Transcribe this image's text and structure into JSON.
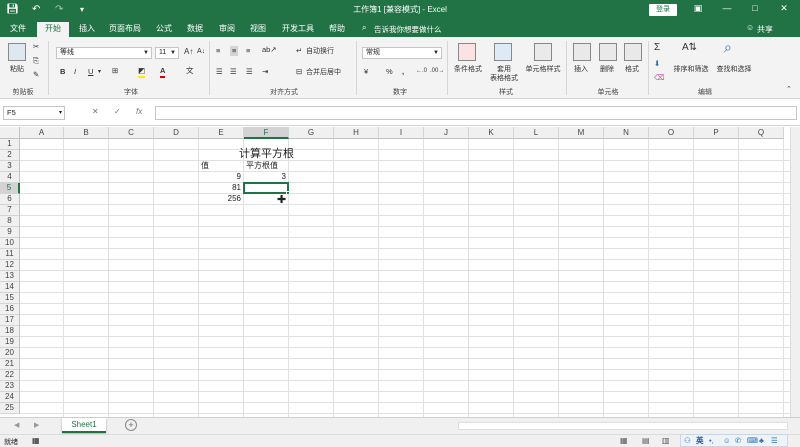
{
  "window": {
    "title": "工作簿1 [兼容模式] - Excel",
    "login_label": "登录",
    "share_label": "共享",
    "accent_color": "#217346"
  },
  "quick_access": {
    "icons": [
      "save-icon",
      "undo-icon",
      "redo-icon",
      "customize-icon"
    ]
  },
  "tabs": [
    "文件",
    "开始",
    "插入",
    "页面布局",
    "公式",
    "数据",
    "审阅",
    "视图",
    "开发工具",
    "帮助"
  ],
  "active_tab": "开始",
  "tell_me": "告诉我你想要做什么",
  "ribbon": {
    "clipboard": {
      "paste_label": "粘贴",
      "group_label": "剪贴板"
    },
    "font": {
      "font_name": "等线",
      "font_size": "11",
      "group_label": "字体"
    },
    "alignment": {
      "wrap_label": "自动换行",
      "merge_label": "合并后居中",
      "group_label": "对齐方式"
    },
    "number": {
      "format": "常规",
      "percent": "%",
      "comma": ",",
      "group_label": "数字"
    },
    "styles": {
      "conditional_label": "条件格式",
      "table_label": "套用\n表格格式",
      "cell_styles_label": "单元格样式",
      "group_label": "样式"
    },
    "cells": {
      "insert_label": "插入",
      "delete_label": "删除",
      "format_label": "格式",
      "group_label": "单元格"
    },
    "editing": {
      "sort_label": "排序和筛选",
      "find_label": "查找和选择",
      "group_label": "编辑"
    }
  },
  "formula_bar": {
    "name_box": "F5",
    "fx_label": "fx",
    "formula": ""
  },
  "columns": [
    "A",
    "B",
    "C",
    "D",
    "E",
    "F",
    "G",
    "H",
    "I",
    "J",
    "K",
    "L",
    "M",
    "N",
    "O",
    "P",
    "Q"
  ],
  "rows": [
    "1",
    "2",
    "3",
    "4",
    "5",
    "6",
    "7",
    "8",
    "9",
    "10",
    "11",
    "12",
    "13",
    "14",
    "15",
    "16",
    "17",
    "18",
    "19",
    "20",
    "21",
    "22",
    "23",
    "24",
    "25"
  ],
  "selected_cell": "F5",
  "cells": {
    "title": "计算平方根",
    "header_value": "值",
    "header_sqrt": "平方根值",
    "e4": "9",
    "f4": "3",
    "e5": "81",
    "e6": "256"
  },
  "sheets": [
    "Sheet1"
  ],
  "status": {
    "ready": "就绪"
  },
  "ime": {
    "lang": "英"
  }
}
